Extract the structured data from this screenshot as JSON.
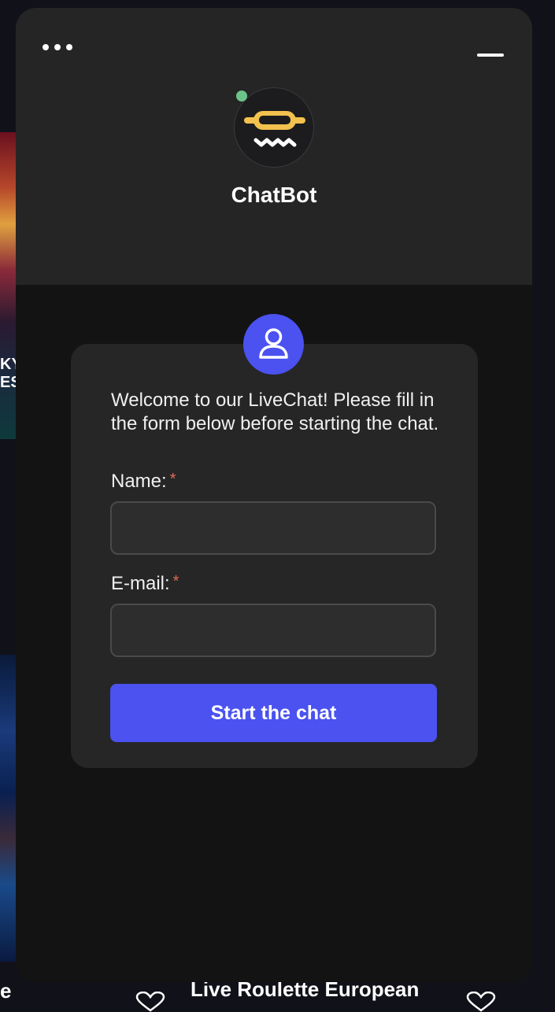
{
  "background": {
    "thumb_text": "KY ES",
    "bottom_left_text": "e",
    "bottom_title": "Live Roulette European"
  },
  "widget": {
    "bot_name": "ChatBot",
    "status": "online",
    "colors": {
      "accent": "#4b52f0",
      "header_bg": "#252525",
      "body_bg": "#131313",
      "card_bg": "#262626",
      "online": "#6cc38a",
      "required": "#e06a5a",
      "logo_yellow": "#f2c14e"
    },
    "icons": {
      "menu": "more-horizontal-icon",
      "minimize": "minimize-icon",
      "user": "user-icon"
    }
  },
  "form": {
    "welcome": "Welcome to our LiveChat! Please fill in the form below before starting the chat.",
    "name_label": "Name:",
    "email_label": "E-mail:",
    "required_mark": "*",
    "name_value": "",
    "name_placeholder": "",
    "email_value": "",
    "email_placeholder": "",
    "submit_label": "Start the chat"
  }
}
